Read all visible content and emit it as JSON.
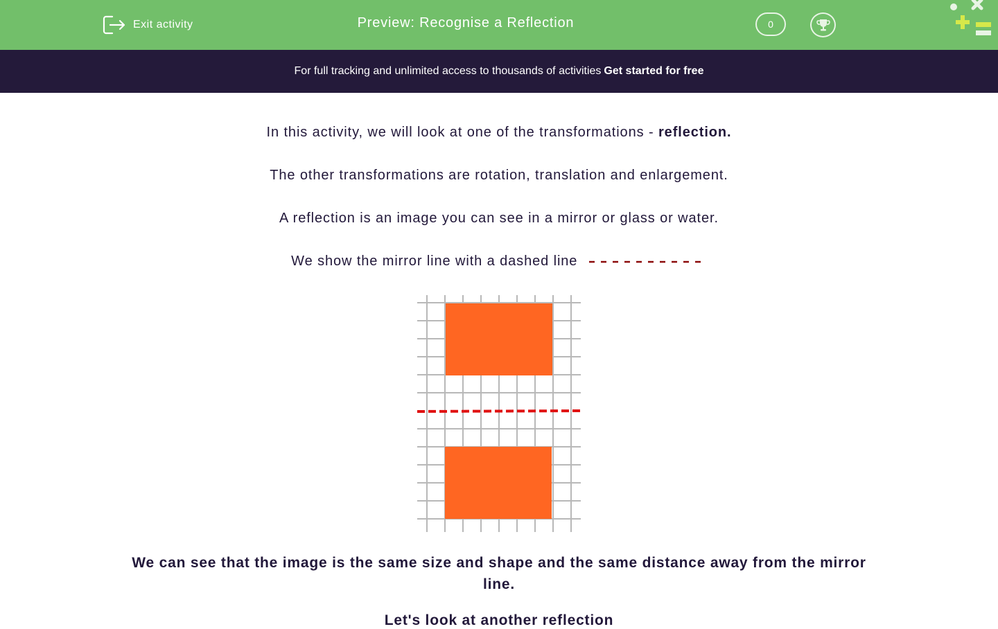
{
  "header": {
    "exit_label": "Exit activity",
    "title": "Preview: Recognise a Reflection",
    "score": "0"
  },
  "banner": {
    "text": "For full tracking and unlimited access to thousands of activities",
    "cta": "Get started for free"
  },
  "lesson": {
    "p1_text": "In this activity, we will look at one of the transformations -",
    "p1_bold": "reflection.",
    "p2": "The other transformations are rotation, translation and enlargement.",
    "p3": "A reflection is an image you can see in a mirror or glass or water.",
    "p4": "We show the mirror line with a dashed line",
    "conclusion": "We can see that the image is the same size and shape and the same distance away from the mirror line.",
    "next_partial": "Let's look at another reflection"
  },
  "colors": {
    "header_bg": "#72bf6a",
    "banner_bg": "#241a3a",
    "text": "#22183a",
    "shape": "#ff6622",
    "mirror_line": "#e01010",
    "dash_inline": "#8b0a0a"
  },
  "icons": [
    "exit-icon",
    "trophy-icon",
    "logo-icon"
  ]
}
